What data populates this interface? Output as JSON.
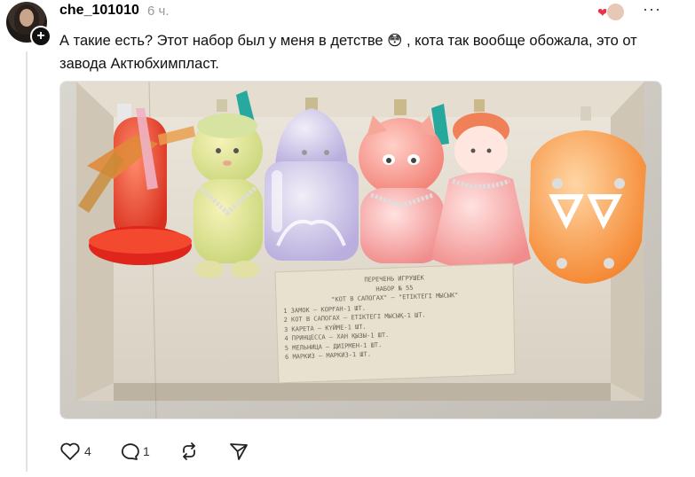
{
  "post": {
    "username": "che_101010",
    "time": "6 ч.",
    "text": "А такие есть? Этот набор был у меня в детстве 😳 , кота так вообще обожала, это от завода Актюбхимпласт.",
    "accent_color": "#e8334a"
  },
  "photo": {
    "card_lines": [
      "ПЕРЕЧЕНЬ ИГРУШЕК",
      "НАБОР № 55",
      "\"КОТ В САПОГАХ\" — \"ЕТІКТЕГІ МЫСЫК\"",
      "1 ЗАМОК — КОРҒАН-1 ШТ.",
      "2 КОТ В САПОГАХ — ЕТІКТЕГІ МЫСЫҚ-1 ШТ.",
      "3 КАРЕТА — КҮЙМЕ-1 ШТ.",
      "4 ПРИНЦЕССА — ХАН ҚЫЗЫ-1 ШТ.",
      "5 МЕЛЬНИЦА — ДИІРМЕН-1 ШТ.",
      "6 МАРКИЗ — МАРКИЗ-1 ШТ."
    ]
  },
  "actions": {
    "likes": "4",
    "comments": "1"
  }
}
